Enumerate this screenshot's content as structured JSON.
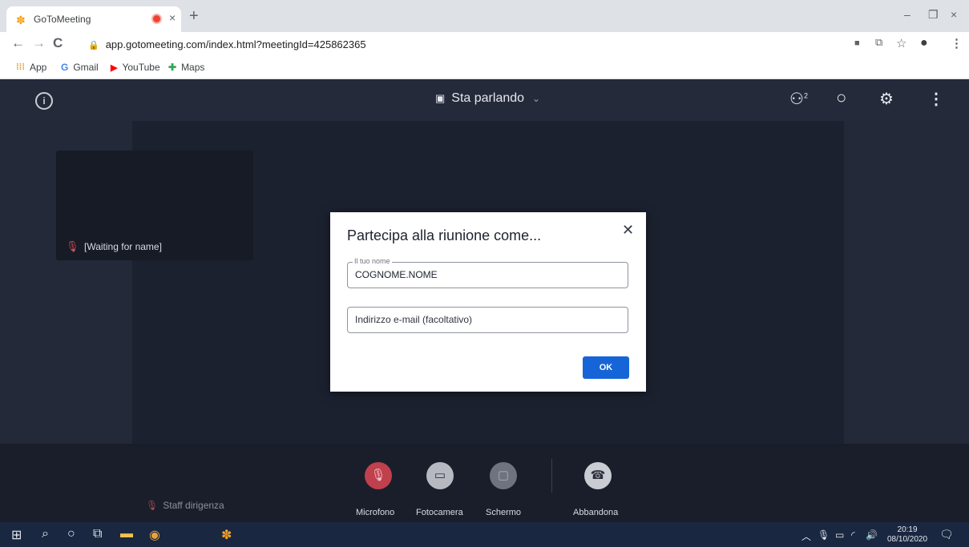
{
  "browser": {
    "tab_title": "GoToMeeting",
    "tab_close": "×",
    "new_tab": "+",
    "window_controls": {
      "minimize": "–",
      "restore": "❐",
      "close": "×"
    },
    "nav": {
      "back": "←",
      "forward": "→",
      "reload": "C"
    },
    "url": "app.gotomeeting.com/index.html?meetingId=425862365",
    "bookmarks": [
      {
        "label": "App",
        "icon": "apps-grid-icon"
      },
      {
        "label": "Gmail",
        "icon": "gmail-icon"
      },
      {
        "label": "YouTube",
        "icon": "youtube-icon"
      },
      {
        "label": "Maps",
        "icon": "maps-icon"
      }
    ]
  },
  "meeting": {
    "view_mode": "Sta parlando",
    "participants_count": "2",
    "participant_tile_name": "[Waiting for name]",
    "presenter_label": "Staff dirigenza",
    "controls": {
      "microphone": "Microfono",
      "camera": "Fotocamera",
      "screen": "Schermo",
      "leave": "Abbandona"
    }
  },
  "dialog": {
    "title": "Partecipa alla riunione come...",
    "name_label": "Il tuo nome",
    "name_value": "COGNOME.NOME",
    "email_placeholder": "Indirizzo e-mail (facoltativo)",
    "ok_label": "OK"
  },
  "taskbar": {
    "time": "20:19",
    "date": "08/10/2020"
  },
  "colors": {
    "meeting_bg": "#1e2331",
    "mic_muted": "#c0404e",
    "ok_button": "#1565d8",
    "taskbar": "#1a2740"
  }
}
